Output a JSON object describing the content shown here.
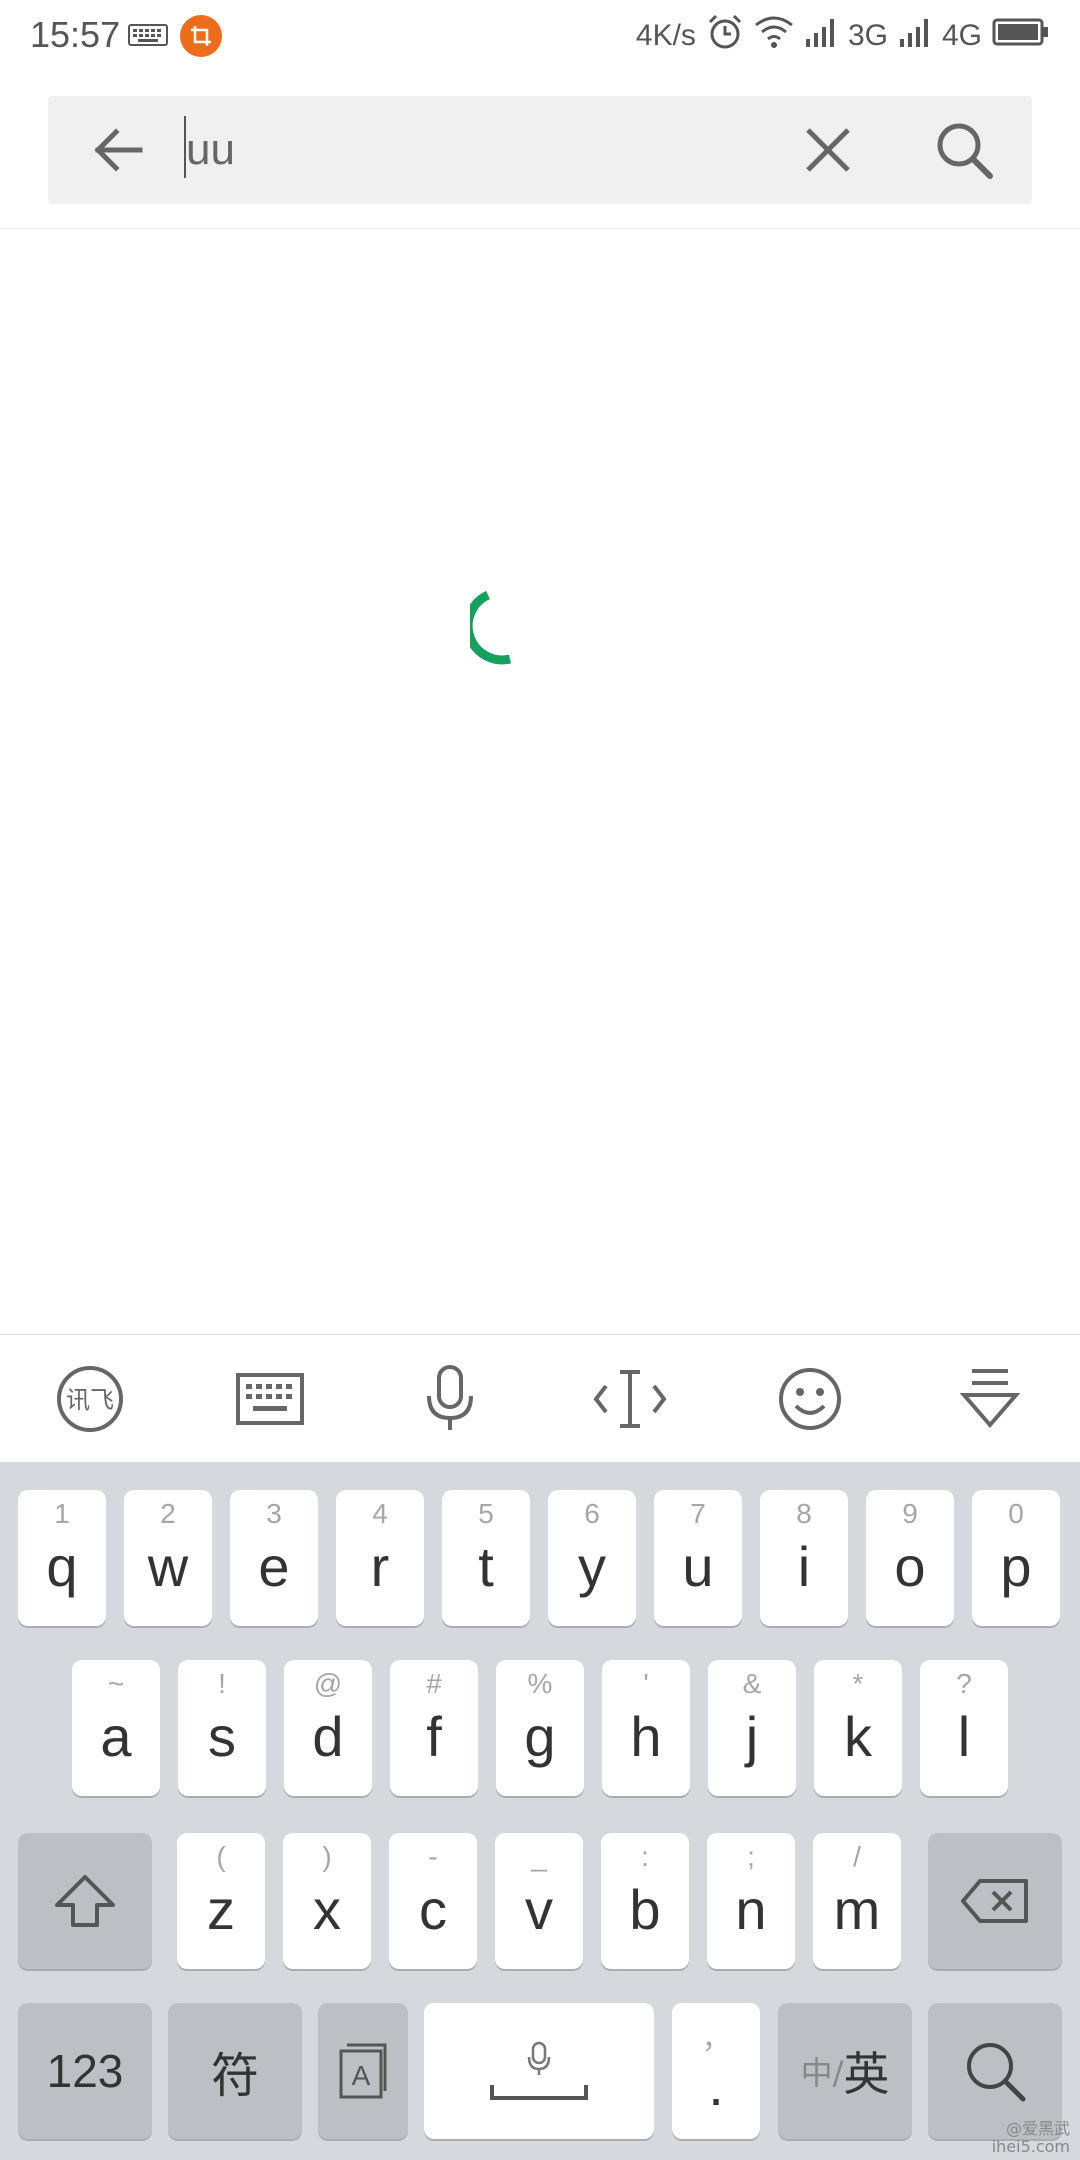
{
  "status_bar": {
    "time": "15:57",
    "net_speed": "4K/s",
    "sim1_type": "3G",
    "sim2_type": "4G"
  },
  "search": {
    "query": "uu"
  },
  "toolbar": {
    "items": [
      "iflytek-icon",
      "keyboard-icon",
      "microphone-icon",
      "cursor-move-icon",
      "emoji-icon",
      "hide-keyboard-icon"
    ],
    "iflytek_label": "讯飞"
  },
  "keyboard": {
    "row1": [
      {
        "key": "q",
        "hint": "1"
      },
      {
        "key": "w",
        "hint": "2"
      },
      {
        "key": "e",
        "hint": "3"
      },
      {
        "key": "r",
        "hint": "4"
      },
      {
        "key": "t",
        "hint": "5"
      },
      {
        "key": "y",
        "hint": "6"
      },
      {
        "key": "u",
        "hint": "7"
      },
      {
        "key": "i",
        "hint": "8"
      },
      {
        "key": "o",
        "hint": "9"
      },
      {
        "key": "p",
        "hint": "0"
      }
    ],
    "row2": [
      {
        "key": "a",
        "hint": "~"
      },
      {
        "key": "s",
        "hint": "!"
      },
      {
        "key": "d",
        "hint": "@"
      },
      {
        "key": "f",
        "hint": "#"
      },
      {
        "key": "g",
        "hint": "%"
      },
      {
        "key": "h",
        "hint": "'"
      },
      {
        "key": "j",
        "hint": "&"
      },
      {
        "key": "k",
        "hint": "*"
      },
      {
        "key": "l",
        "hint": "?"
      }
    ],
    "row3": [
      {
        "key": "z",
        "hint": "("
      },
      {
        "key": "x",
        "hint": ")"
      },
      {
        "key": "c",
        "hint": "-"
      },
      {
        "key": "v",
        "hint": "_"
      },
      {
        "key": "b",
        "hint": ":"
      },
      {
        "key": "n",
        "hint": ";"
      },
      {
        "key": "m",
        "hint": "/"
      }
    ],
    "num_label": "123",
    "symbol_label": "符",
    "period_label": ".",
    "period_hint": "，",
    "lang_zh": "中/",
    "lang_en": "英"
  },
  "watermark": {
    "line1": "@爱黑武",
    "line2": "ihei5.com"
  },
  "colors": {
    "accent": "#16a05d",
    "keyboard_bg": "#d5d9dd",
    "key_dark": "#bcc0c4"
  }
}
